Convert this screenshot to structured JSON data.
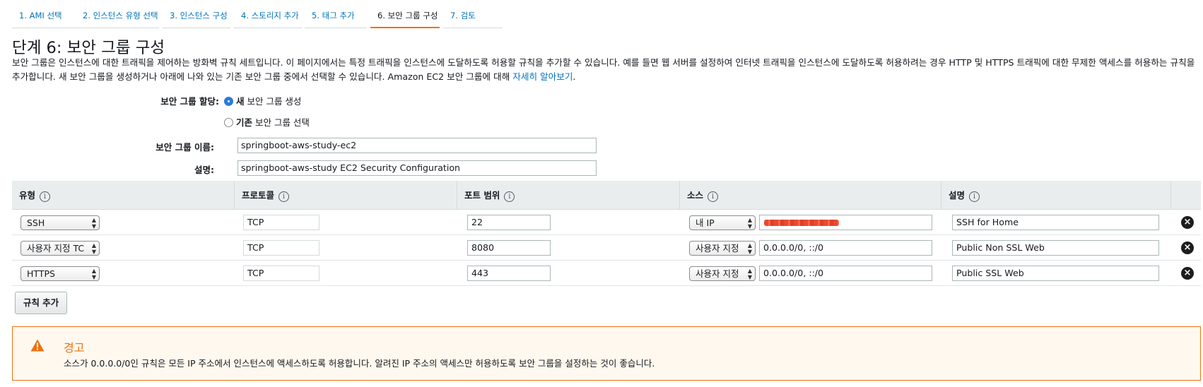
{
  "tabs": [
    {
      "label": "1. AMI 선택"
    },
    {
      "label": "2. 인스턴스 유형 선택"
    },
    {
      "label": "3. 인스턴스 구성"
    },
    {
      "label": "4. 스토리지 추가"
    },
    {
      "label": "5. 태그 추가"
    },
    {
      "label": "6. 보안 그룹 구성"
    },
    {
      "label": "7. 검토"
    }
  ],
  "active_tab_index": 5,
  "page": {
    "title": "단계 6: 보안 그룹 구성",
    "description": "보안 그룹은 인스턴스에 대한 트래픽을 제어하는 방화벽 규칙 세트입니다. 이 페이지에서는 특정 트래픽을 인스턴스에 도달하도록 허용할 규칙을 추가할 수 있습니다. 예를 들면 웹 서버를 설정하여 인터넷 트래픽을 인스턴스에 도달하도록 허용하려는 경우 HTTP 및 HTTPS 트래픽에 대한 무제한 액세스를 허용하는 규칙을 추가합니다. 새 보안 그룹을 생성하거나 아래에 나와 있는 기존 보안 그룹 중에서 선택할 수 있습니다. Amazon EC2 보안 그룹에 대해 ",
    "learn_more_link": "자세히 알아보기",
    "description_end": "."
  },
  "form": {
    "assign_label": "보안 그룹 할당:",
    "option_new_bold": "새",
    "option_new_rest": " 보안 그룹 생성",
    "option_existing_bold": "기존",
    "option_existing_rest": " 보안 그룹 선택",
    "selected_option": "new",
    "name_label": "보안 그룹 이름:",
    "name_value": "springboot-aws-study-ec2",
    "desc_label": "설명:",
    "desc_value": "springboot-aws-study EC2 Security Configuration"
  },
  "table": {
    "headers": [
      "유형",
      "프로토콜",
      "포트 범위",
      "소스",
      "설명"
    ],
    "info_glyph": "i",
    "rows": [
      {
        "type": "SSH",
        "protocol": "TCP",
        "port": "22",
        "source_type": "내 IP",
        "source_value": "",
        "source_redacted": true,
        "description": "SSH for Home"
      },
      {
        "type": "사용자 지정 TC",
        "protocol": "TCP",
        "port": "8080",
        "source_type": "사용자 지정",
        "source_value": "0.0.0.0/0, ::/0",
        "source_redacted": false,
        "description": "Public Non SSL Web"
      },
      {
        "type": "HTTPS",
        "protocol": "TCP",
        "port": "443",
        "source_type": "사용자 지정",
        "source_value": "0.0.0.0/0, ::/0",
        "source_redacted": false,
        "description": "Public SSL Web"
      }
    ]
  },
  "add_rule_label": "규칙 추가",
  "warning": {
    "title": "경고",
    "message": "소스가 0.0.0.0/0인 규칙은 모든 IP 주소에서 인스턴스에 액세스하도록 허용합니다. 알려진 IP 주소의 액세스만 허용하도록 보안 그룹을 설정하는 것이 좋습니다.",
    "icon": "warning-triangle-icon"
  },
  "colors": {
    "link": "#0073bb",
    "accent": "#ec7211",
    "header_bg": "#eaeded",
    "warning_bg": "#fef8ee"
  }
}
